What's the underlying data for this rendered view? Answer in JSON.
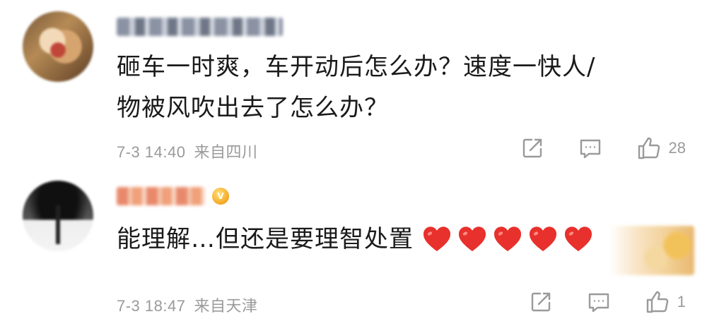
{
  "comments": [
    {
      "username": "",
      "text_line1": "砸车一时爽，车开动后怎么办？速度一快人/",
      "text_line2": "物被风吹出去了怎么办？",
      "time": "7-3 14:40",
      "location": "来自四川",
      "likes": "28"
    },
    {
      "username": "",
      "text": "能理解…但还是要理智处置",
      "emoji": [
        "heart",
        "heart",
        "heart",
        "heart",
        "heart"
      ],
      "time": "7-3 18:47",
      "location": "来自天津",
      "likes": "1"
    }
  ],
  "icons": {
    "share": "share-icon",
    "reply": "comment-icon",
    "like": "thumbs-up-icon"
  },
  "colors": {
    "text": "#1a1a1a",
    "meta": "#9a9a9a",
    "heart": "#e8302c"
  }
}
